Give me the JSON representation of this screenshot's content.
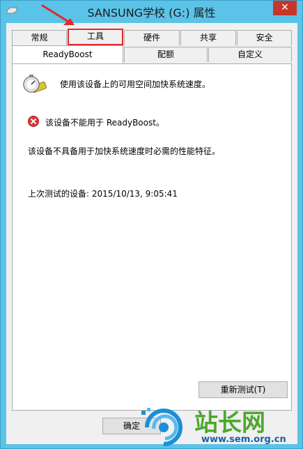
{
  "window": {
    "title": "SANSUNG学校 (G:) 属性",
    "close_glyph": "✕"
  },
  "tabs_row1": [
    {
      "label": "常规"
    },
    {
      "label": "工具"
    },
    {
      "label": "硬件"
    },
    {
      "label": "共享"
    },
    {
      "label": "安全"
    }
  ],
  "tabs_row2": [
    {
      "label": "ReadyBoost"
    },
    {
      "label": "配额"
    },
    {
      "label": "自定义"
    }
  ],
  "readyboost": {
    "description": "使用该设备上的可用空间加快系统速度。",
    "error_text": "该设备不能用于 ReadyBoost。",
    "detail_text": "该设备不具备用于加快系统速度时必需的性能特征。",
    "last_test": "上次测试的设备: 2015/10/13, 9:05:41",
    "retest_label": "重新测试(T)"
  },
  "footer": {
    "ok_label": "确定"
  },
  "watermark": {
    "site_name": "站长网",
    "url": "www.sem.org.cn"
  },
  "colors": {
    "titlebar": "#5cc3e8",
    "close": "#c7362b",
    "highlight": "#e02a2a"
  }
}
